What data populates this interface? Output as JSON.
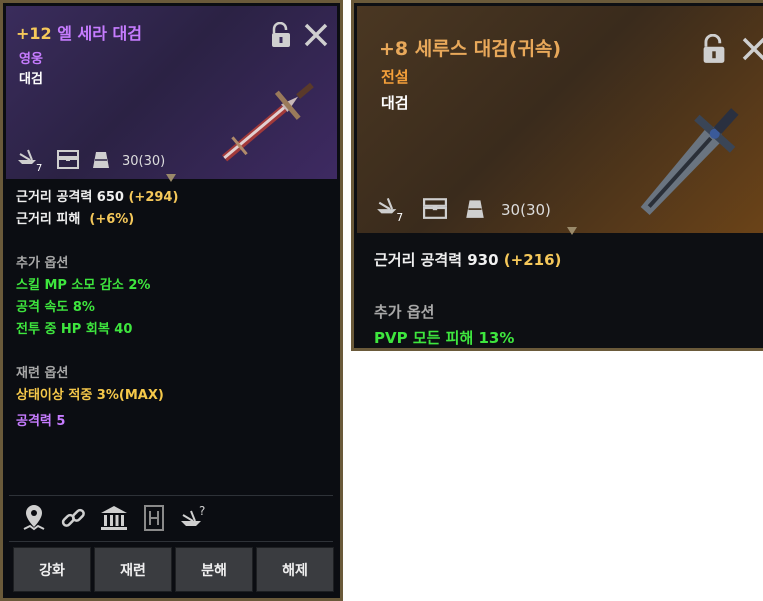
{
  "left": {
    "title_plus": "+12",
    "title_name": "엘 세라 대검",
    "grade": "영웅",
    "type": "대검",
    "durability": "30(30)",
    "stats": [
      {
        "label": "근거리 공격력 650",
        "bonus": "(+294)"
      },
      {
        "label": "근거리 피해",
        "bonus": "(+6%)"
      }
    ],
    "extra_header": "추가 옵션",
    "extra_options": [
      "스킬 MP 소모 감소 2%",
      "공격 속도 8%",
      "전투 중 HP 회복 40"
    ],
    "reroll_header": "재련 옵션",
    "reroll_options": [
      "상태이상 적중 3%(MAX)"
    ],
    "special_option": "공격력 5",
    "buttons": [
      "강화",
      "재련",
      "분해",
      "해제"
    ],
    "forge_level": "7"
  },
  "right": {
    "title": "+8 세루스 대검(귀속)",
    "grade": "전설",
    "type": "대검",
    "durability": "30(30)",
    "stat_label": "근거리 공격력 930",
    "stat_bonus": "(+216)",
    "extra_header": "추가 옵션",
    "extra_options": [
      "PVP 모든 피해 13%"
    ],
    "forge_level": "7"
  },
  "colors": {
    "hero_purple": "#c67cff",
    "legend_orange": "#f5a03a",
    "option_green": "#3ee63e",
    "bonus_gold": "#f5c85a"
  }
}
